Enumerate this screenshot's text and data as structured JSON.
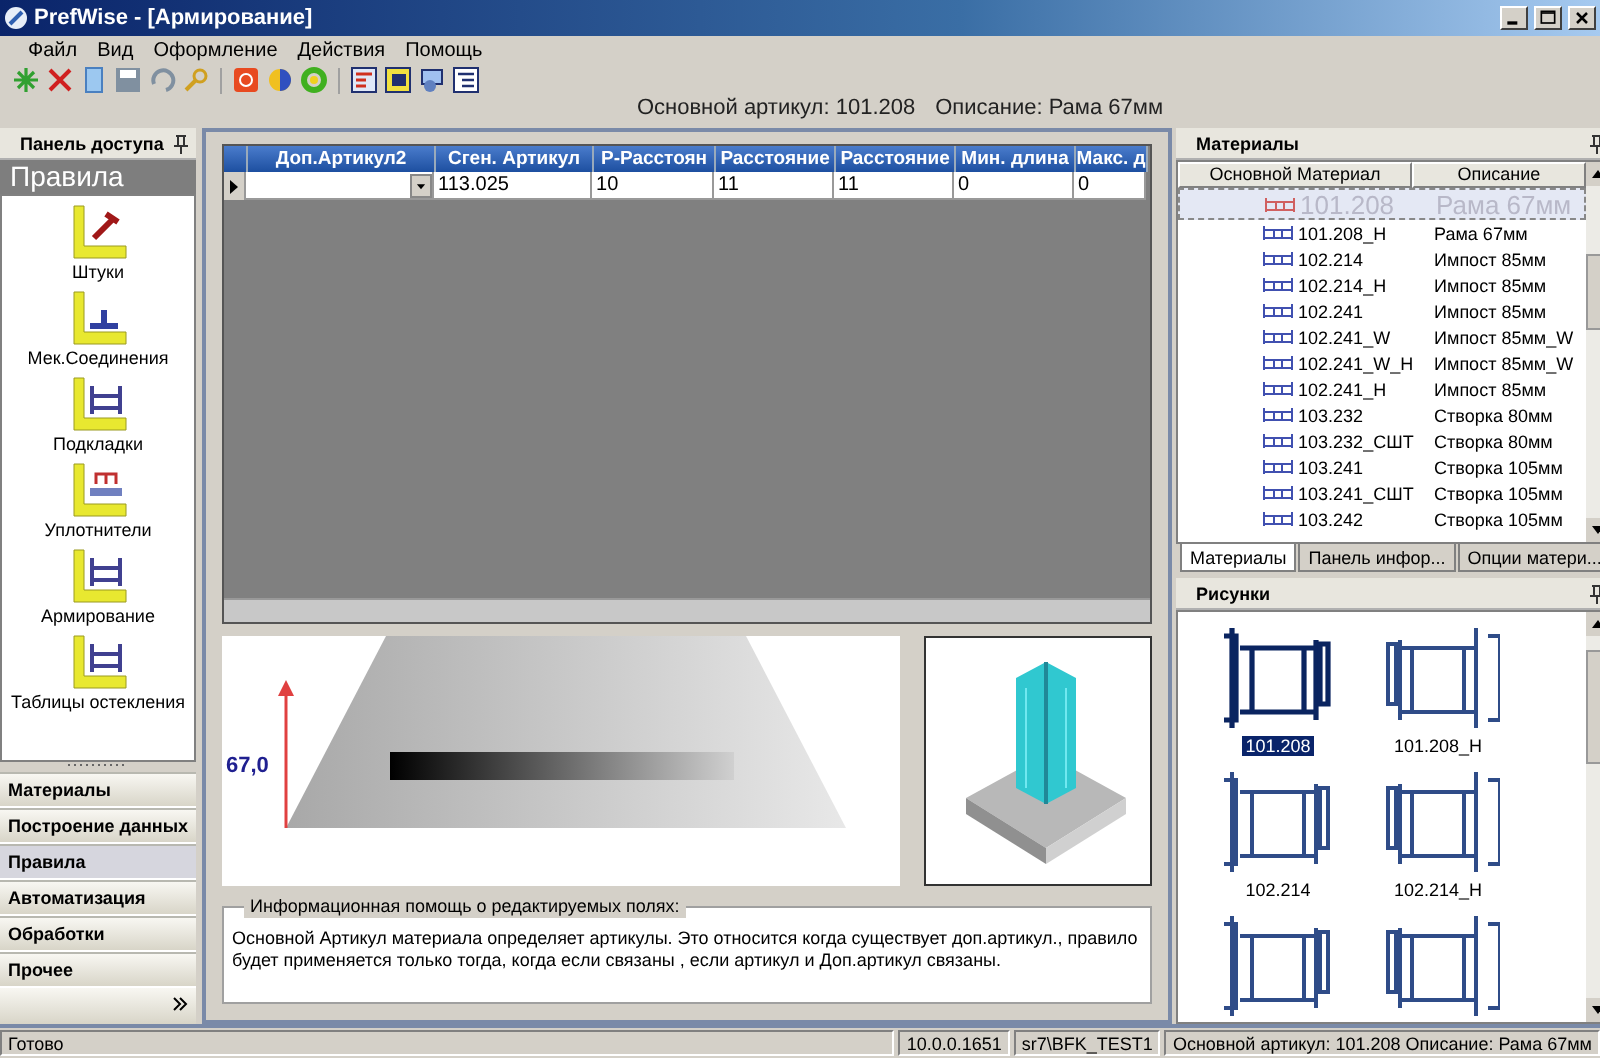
{
  "window": {
    "title": "PrefWise - [Армирование]"
  },
  "menu": [
    "Файл",
    "Вид",
    "Оформление",
    "Действия",
    "Помощь"
  ],
  "header": {
    "article": "Основной артикул: 101.208",
    "description": "Описание: Рама 67мм"
  },
  "access_panel": {
    "title": "Панель доступа",
    "section": "Правила",
    "items": [
      {
        "label": "Штуки"
      },
      {
        "label": "Мек.Соединения"
      },
      {
        "label": "Подкладки"
      },
      {
        "label": "Уплотнители"
      },
      {
        "label": "Армирование"
      },
      {
        "label": "Таблицы остекления"
      }
    ],
    "nav": [
      {
        "label": "Материалы",
        "selected": false
      },
      {
        "label": "Построение данных",
        "selected": false
      },
      {
        "label": "Правила",
        "selected": true
      },
      {
        "label": "Автоматизация",
        "selected": false
      },
      {
        "label": "Обработки",
        "selected": false
      },
      {
        "label": "Прочее",
        "selected": false
      }
    ]
  },
  "grid": {
    "columns": [
      "Доп.Артикул2",
      "Сген. Артикул",
      "Р-Расстоян",
      "Расстояние",
      "Расстояние",
      "Мин. длина",
      "Макс. д"
    ],
    "rows": [
      {
        "cells": [
          "",
          "113.025",
          "10",
          "11",
          "11",
          "0",
          "0"
        ]
      }
    ]
  },
  "drawing": {
    "dimension": "67,0"
  },
  "info": {
    "legend": "Информационная помощь о редактируемых полях:",
    "text": "Основной Артикул материала определяет артикулы. Это относится когда существует доп.артикул., правило будет применяется только тогда, когда если связаны , если артикул и Доп.артикул связаны."
  },
  "materials": {
    "title": "Материалы",
    "columns": [
      "Основной Материал",
      "Описание"
    ],
    "rows": [
      {
        "article": "101.208",
        "description": "Рама 67мм",
        "selected": true
      },
      {
        "article": "101.208_H",
        "description": "Рама 67мм",
        "selected": false
      },
      {
        "article": "102.214",
        "description": "Импост 85мм",
        "selected": false
      },
      {
        "article": "102.214_H",
        "description": "Импост 85мм",
        "selected": false
      },
      {
        "article": "102.241",
        "description": "Импост 85мм",
        "selected": false
      },
      {
        "article": "102.241_W",
        "description": "Импост 85мм_W",
        "selected": false
      },
      {
        "article": "102.241_W_H",
        "description": "Импост 85мм_W",
        "selected": false
      },
      {
        "article": "102.241_H",
        "description": "Импост 85мм",
        "selected": false
      },
      {
        "article": "103.232",
        "description": "Створка 80мм",
        "selected": false
      },
      {
        "article": "103.232_СШТ",
        "description": "Створка 80мм",
        "selected": false
      },
      {
        "article": "103.241",
        "description": "Створка 105мм",
        "selected": false
      },
      {
        "article": "103.241_СШТ",
        "description": "Створка 105мм",
        "selected": false
      },
      {
        "article": "103.242",
        "description": "Створка 105мм",
        "selected": false
      }
    ],
    "tabs": [
      {
        "label": "Материалы",
        "selected": true
      },
      {
        "label": "Панель инфор...",
        "selected": false
      },
      {
        "label": "Опции матери...",
        "selected": false
      }
    ]
  },
  "pictures": {
    "title": "Рисунки",
    "items": [
      {
        "label": "101.208",
        "selected": true
      },
      {
        "label": "101.208_H",
        "selected": false
      },
      {
        "label": "102.214",
        "selected": false
      },
      {
        "label": "102.214_H",
        "selected": false
      },
      {
        "selected": false
      },
      {
        "selected": false
      }
    ]
  },
  "status_bar": [
    "Готово",
    "10.0.0.1651",
    "sr7\\BFK_TEST1",
    "Основной артикул: 101.208   Описание: Рама 67мм"
  ]
}
